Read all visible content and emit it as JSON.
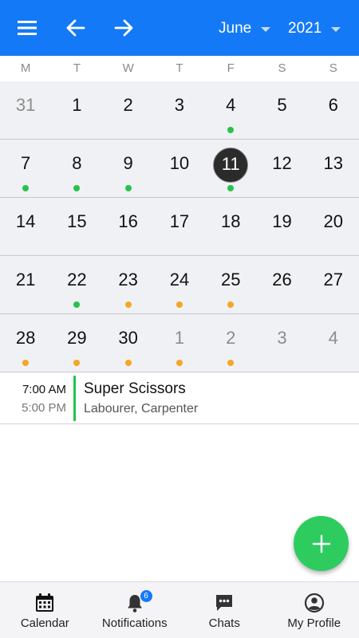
{
  "header": {
    "month": "June",
    "year": "2021"
  },
  "weekdays": [
    "M",
    "T",
    "W",
    "T",
    "F",
    "S",
    "S"
  ],
  "calendar": {
    "weeks": [
      {
        "days": [
          {
            "num": "31",
            "other": true,
            "dot": null
          },
          {
            "num": "1",
            "other": false,
            "dot": null
          },
          {
            "num": "2",
            "other": false,
            "dot": null
          },
          {
            "num": "3",
            "other": false,
            "dot": null
          },
          {
            "num": "4",
            "other": false,
            "dot": "green"
          },
          {
            "num": "5",
            "other": false,
            "dot": null
          },
          {
            "num": "6",
            "other": false,
            "dot": null
          }
        ]
      },
      {
        "days": [
          {
            "num": "7",
            "other": false,
            "dot": "green"
          },
          {
            "num": "8",
            "other": false,
            "dot": "green"
          },
          {
            "num": "9",
            "other": false,
            "dot": "green"
          },
          {
            "num": "10",
            "other": false,
            "dot": null
          },
          {
            "num": "11",
            "other": false,
            "dot": "green",
            "selected": true
          },
          {
            "num": "12",
            "other": false,
            "dot": null
          },
          {
            "num": "13",
            "other": false,
            "dot": null
          }
        ]
      },
      {
        "days": [
          {
            "num": "14",
            "other": false,
            "dot": null
          },
          {
            "num": "15",
            "other": false,
            "dot": null
          },
          {
            "num": "16",
            "other": false,
            "dot": null
          },
          {
            "num": "17",
            "other": false,
            "dot": null
          },
          {
            "num": "18",
            "other": false,
            "dot": null
          },
          {
            "num": "19",
            "other": false,
            "dot": null
          },
          {
            "num": "20",
            "other": false,
            "dot": null
          }
        ]
      },
      {
        "days": [
          {
            "num": "21",
            "other": false,
            "dot": null
          },
          {
            "num": "22",
            "other": false,
            "dot": "green"
          },
          {
            "num": "23",
            "other": false,
            "dot": "orange"
          },
          {
            "num": "24",
            "other": false,
            "dot": "orange"
          },
          {
            "num": "25",
            "other": false,
            "dot": "orange"
          },
          {
            "num": "26",
            "other": false,
            "dot": null
          },
          {
            "num": "27",
            "other": false,
            "dot": null
          }
        ]
      },
      {
        "days": [
          {
            "num": "28",
            "other": false,
            "dot": "orange"
          },
          {
            "num": "29",
            "other": false,
            "dot": "orange"
          },
          {
            "num": "30",
            "other": false,
            "dot": "orange"
          },
          {
            "num": "1",
            "other": true,
            "dot": "orange"
          },
          {
            "num": "2",
            "other": true,
            "dot": "orange"
          },
          {
            "num": "3",
            "other": true,
            "dot": null
          },
          {
            "num": "4",
            "other": true,
            "dot": null
          }
        ]
      }
    ]
  },
  "event": {
    "start_time": "7:00 AM",
    "end_time": "5:00 PM",
    "title": "Super Scissors",
    "subtitle": "Labourer, Carpenter"
  },
  "nav": {
    "calendar": "Calendar",
    "notifications": "Notifications",
    "notifications_badge": "6",
    "chats": "Chats",
    "profile": "My Profile"
  },
  "colors": {
    "header": "#1479f6",
    "status_green": "#27c24c",
    "status_orange": "#f5a623",
    "fab": "#2ecc5f"
  }
}
